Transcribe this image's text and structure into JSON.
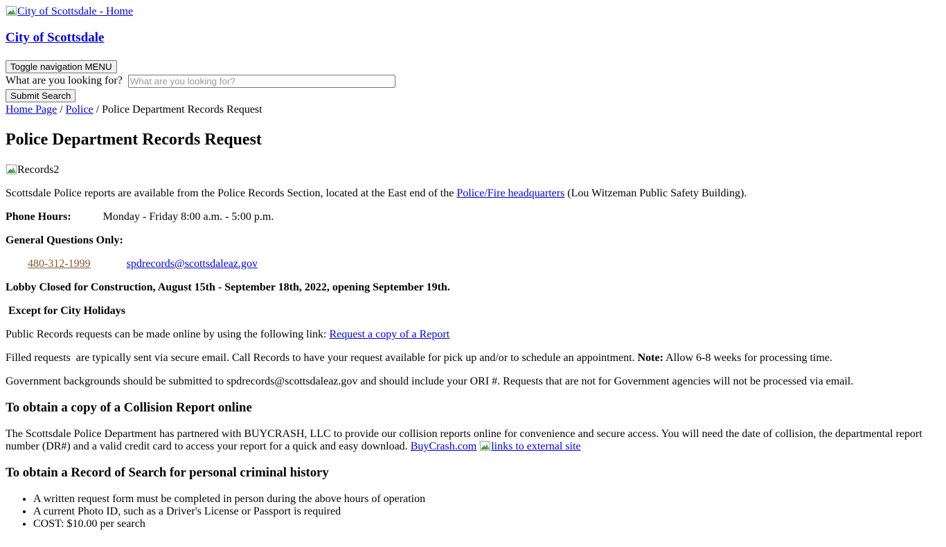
{
  "browser": {
    "page_title": "Police Department Records Request"
  },
  "header": {
    "logo_alt": "City of Scottsdale - Home",
    "logo_icon": "broken-image-icon",
    "site_title": "City of Scottsdale",
    "nav_toggle_label": "Toggle navigation MENU",
    "search": {
      "label": "What are you looking for?",
      "placeholder": "What are you looking for?",
      "value": "",
      "submit_label": "Submit Search"
    }
  },
  "breadcrumb": {
    "items": [
      {
        "label": "Home Page",
        "is_link": true
      },
      {
        "label": "Police",
        "is_link": true
      },
      {
        "label": "Police Department Records Request",
        "is_link": false
      }
    ],
    "separator": "/"
  },
  "main": {
    "page_title": "Police Department Records Request",
    "records_image_alt": "Records2",
    "records_image_icon": "broken-image-icon",
    "intro": {
      "before_link": "Scottsdale Police reports are available from the Police Records Section, located at the East end of the ",
      "link_text": "Police/Fire headquarters",
      "after_link": " (Lou Witzeman Public Safety Building)."
    },
    "phone_hours": {
      "label": "Phone Hours:",
      "value": "Monday - Friday 8:00 a.m. - 5:00 p.m."
    },
    "general_questions_heading": "General Questions Only:",
    "contact": {
      "phone": "480-312-1999",
      "email": "spdrecords@scottsdaleaz.gov"
    },
    "lobby_notice": "Lobby Closed for Construction, August 15th - September 18th, 2022, opening September 19th.",
    "holidays_notice": " Except for City Holidays",
    "public_records": {
      "before_link": "Public Records requests can be made online by using the following link: ",
      "link_text": "Request a copy of a Report"
    },
    "filled_requests": {
      "part1": "Filled requests  are typically sent via secure email. Call Records to have your request available for pick up and/or to schedule an appointment. ",
      "note_label": "Note:",
      "part2": " Allow 6-8 weeks for processing time."
    },
    "government_backgrounds": "Government backgrounds should be submitted to spdrecords@scottsdaleaz.gov and should include your ORI #. Requests that are not for Government agencies will not be processed via email.",
    "collision": {
      "heading": "To obtain a copy of a Collision Report online",
      "body": "The Scottsdale Police Department has partnered with BUYCRASH, LLC to provide our collision reports online for convenience and secure access. You will need the date of collision, the departmental report number (DR#) and a valid credit card to access your report for a quick and easy download. ",
      "link_text": "BuyCrash.com",
      "external_icon_alt": "links to external site",
      "external_icon": "broken-image-icon"
    },
    "record_of_search": {
      "heading": "To obtain a Record of Search for personal criminal history",
      "bullets": [
        "A written request form must be completed in person during the above hours of operation",
        "A current Photo ID, such as a Driver's License or Passport is required",
        "COST: $10.00 per search"
      ]
    }
  },
  "colors": {
    "link": "#0000EE",
    "visited_link": "#85592B",
    "text": "#000000",
    "background": "#FFFFFF",
    "button_face": "#EFEFEF",
    "placeholder": "#999999"
  }
}
